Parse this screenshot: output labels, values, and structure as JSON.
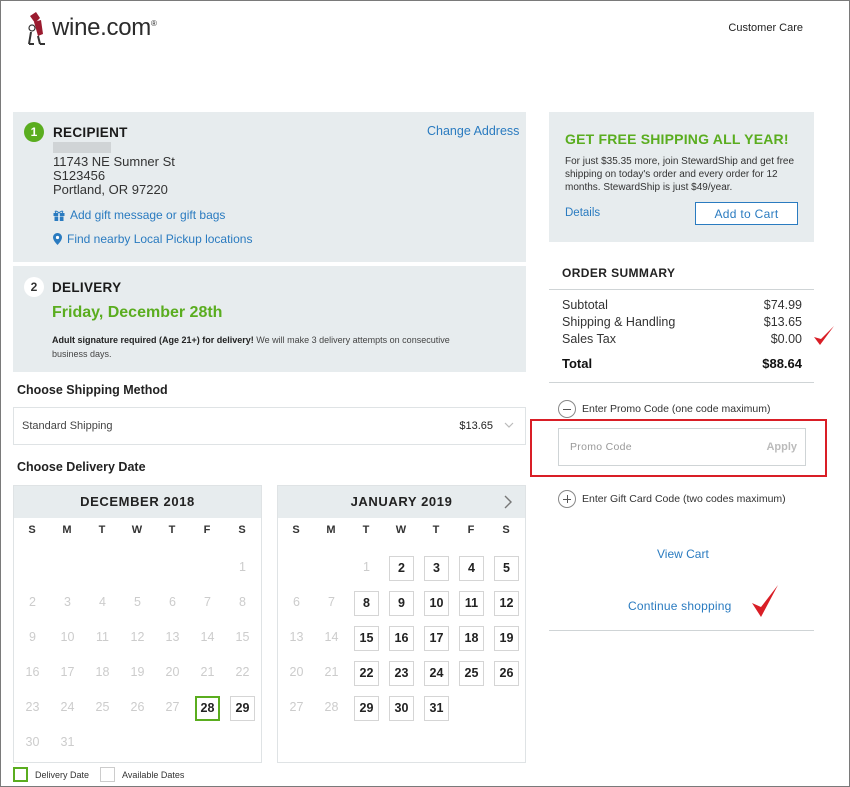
{
  "header": {
    "logo_text": "wine.com",
    "logo_reg": "®",
    "customer_care": "Customer Care"
  },
  "recipient": {
    "step": "1",
    "title": "RECIPIENT",
    "change_address": "Change Address",
    "address_line1": "11743 NE Sumner St",
    "address_line2": "S123456",
    "address_line3": "Portland, OR 97220",
    "gift_link": "Add gift message or gift bags",
    "pickup_link": "Find nearby Local Pickup locations"
  },
  "delivery": {
    "step": "2",
    "title": "DELIVERY",
    "date": "Friday, December 28th",
    "note_bold": "Adult signature required (Age 21+) for delivery!",
    "note_rest": " We will make 3 delivery attempts on consecutive business days."
  },
  "shipping": {
    "heading": "Choose Shipping Method",
    "method": "Standard Shipping",
    "price": "$13.65"
  },
  "delivery_date": {
    "heading": "Choose Delivery Date",
    "dow": [
      "S",
      "M",
      "T",
      "W",
      "T",
      "F",
      "S"
    ],
    "calendars": [
      {
        "title": "DECEMBER 2018",
        "first_weekday": 6,
        "days_in_month": 31,
        "available": [
          28,
          29
        ],
        "selected": 28,
        "has_next": false
      },
      {
        "title": "JANUARY 2019",
        "first_weekday": 2,
        "days_in_month": 31,
        "available": [
          2,
          3,
          4,
          5,
          8,
          9,
          10,
          11,
          12,
          15,
          16,
          17,
          18,
          19,
          22,
          23,
          24,
          25,
          26,
          29,
          30,
          31
        ],
        "selected": null,
        "has_next": true
      }
    ],
    "legend_delivery": "Delivery Date",
    "legend_available": "Available Dates"
  },
  "stewardship": {
    "title": "GET FREE SHIPPING ALL YEAR!",
    "text": "For just $35.35 more, join StewardShip and get free shipping on today's order and every order for 12 months. StewardShip is just $49/year.",
    "details": "Details",
    "add_to_cart": "Add to Cart"
  },
  "order_summary": {
    "title": "ORDER SUMMARY",
    "rows": [
      {
        "label": "Subtotal",
        "amount": "$74.99"
      },
      {
        "label": "Shipping & Handling",
        "amount": "$13.65"
      },
      {
        "label": "Sales Tax",
        "amount": "$0.00"
      }
    ],
    "total_label": "Total",
    "total_amount": "$88.64"
  },
  "codes": {
    "promo_toggle": "Enter Promo Code (one code maximum)",
    "promo_placeholder": "Promo Code",
    "apply": "Apply",
    "gift_toggle": "Enter Gift Card Code (two codes maximum)"
  },
  "links": {
    "view_cart": "View Cart",
    "continue_shopping": "Continue shopping"
  },
  "colors": {
    "accent_green": "#5aad1f",
    "link_blue": "#2a7bc0",
    "annotation_red": "#d91e26",
    "panel_bg": "#e7ecee"
  }
}
